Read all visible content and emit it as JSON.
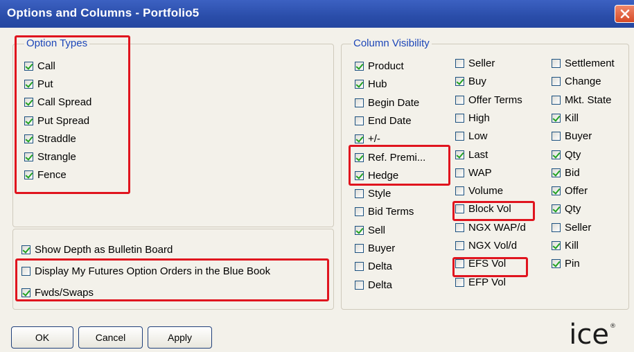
{
  "window": {
    "title": "Options and Columns - Portfolio5"
  },
  "option_types": {
    "title": "Option Types",
    "items": [
      {
        "label": "Call",
        "checked": true
      },
      {
        "label": "Put",
        "checked": true
      },
      {
        "label": "Call Spread",
        "checked": true
      },
      {
        "label": "Put Spread",
        "checked": true
      },
      {
        "label": "Straddle",
        "checked": true
      },
      {
        "label": "Strangle",
        "checked": true
      },
      {
        "label": "Fence",
        "checked": true
      }
    ]
  },
  "display_options": [
    {
      "label": "Show Depth as Bulletin Board",
      "checked": true
    },
    {
      "label": "Display My Futures Option Orders in the Blue Book",
      "checked": false
    },
    {
      "label": "Fwds/Swaps",
      "checked": true
    }
  ],
  "column_visibility": {
    "title": "Column Visibility",
    "col1": [
      {
        "label": "Product",
        "checked": true
      },
      {
        "label": "Hub",
        "checked": true
      },
      {
        "label": "Begin Date",
        "checked": false
      },
      {
        "label": "End Date",
        "checked": false
      },
      {
        "label": "+/-",
        "checked": true
      },
      {
        "label": "Ref. Premi...",
        "checked": true
      },
      {
        "label": "Hedge",
        "checked": true
      },
      {
        "label": "Style",
        "checked": false
      },
      {
        "label": "Bid Terms",
        "checked": false
      },
      {
        "label": "Sell",
        "checked": true
      },
      {
        "label": "Buyer",
        "checked": false
      },
      {
        "label": "Delta",
        "checked": false
      },
      {
        "label": "Delta",
        "checked": false
      }
    ],
    "col2": [
      {
        "label": "Seller",
        "checked": false
      },
      {
        "label": "Buy",
        "checked": true
      },
      {
        "label": "Offer Terms",
        "checked": false
      },
      {
        "label": "High",
        "checked": false
      },
      {
        "label": "Low",
        "checked": false
      },
      {
        "label": "Last",
        "checked": true
      },
      {
        "label": "WAP",
        "checked": false
      },
      {
        "label": "Volume",
        "checked": false
      },
      {
        "label": "Block Vol",
        "checked": false
      },
      {
        "label": "NGX WAP/d",
        "checked": false
      },
      {
        "label": "NGX Vol/d",
        "checked": false
      },
      {
        "label": "EFS Vol",
        "checked": false
      },
      {
        "label": "EFP Vol",
        "checked": false
      }
    ],
    "col3": [
      {
        "label": "Settlement",
        "checked": false
      },
      {
        "label": "Change",
        "checked": false
      },
      {
        "label": "Mkt. State",
        "checked": false
      },
      {
        "label": "Kill",
        "checked": true
      },
      {
        "label": "Buyer",
        "checked": false
      },
      {
        "label": "Qty",
        "checked": true
      },
      {
        "label": "Bid",
        "checked": true
      },
      {
        "label": "Offer",
        "checked": true
      },
      {
        "label": "Qty",
        "checked": true
      },
      {
        "label": "Seller",
        "checked": false
      },
      {
        "label": "Kill",
        "checked": true
      },
      {
        "label": "Pin",
        "checked": true
      }
    ]
  },
  "buttons": {
    "ok": "OK",
    "cancel": "Cancel",
    "apply": "Apply"
  },
  "logo": {
    "text": "ICE",
    "tm": "®"
  },
  "colors": {
    "title_bar": "#2a4da9",
    "group_title": "#1c46b8",
    "highlight_box": "#e0141e",
    "check": "#21a121"
  }
}
